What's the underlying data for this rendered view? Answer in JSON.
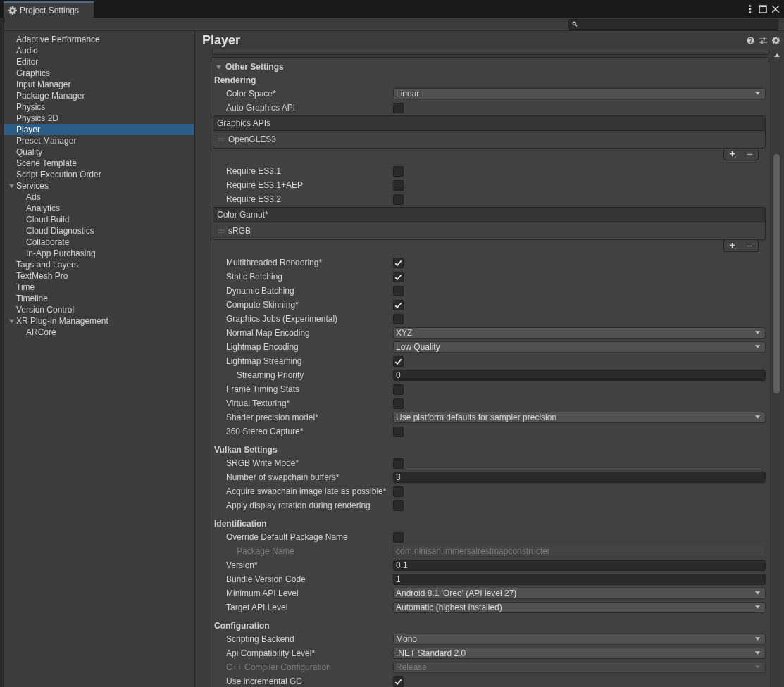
{
  "window": {
    "title": "Project Settings"
  },
  "sidebar": {
    "items": [
      {
        "label": "Adaptive Performance",
        "selected": false
      },
      {
        "label": "Audio",
        "selected": false
      },
      {
        "label": "Editor",
        "selected": false
      },
      {
        "label": "Graphics",
        "selected": false
      },
      {
        "label": "Input Manager",
        "selected": false
      },
      {
        "label": "Package Manager",
        "selected": false
      },
      {
        "label": "Physics",
        "selected": false
      },
      {
        "label": "Physics 2D",
        "selected": false
      },
      {
        "label": "Player",
        "selected": true
      },
      {
        "label": "Preset Manager",
        "selected": false
      },
      {
        "label": "Quality",
        "selected": false
      },
      {
        "label": "Scene Template",
        "selected": false
      },
      {
        "label": "Script Execution Order",
        "selected": false
      },
      {
        "label": "Services",
        "selected": false,
        "expanded": true,
        "children": [
          {
            "label": "Ads",
            "selected": false
          },
          {
            "label": "Analytics",
            "selected": false
          },
          {
            "label": "Cloud Build",
            "selected": false
          },
          {
            "label": "Cloud Diagnostics",
            "selected": false
          },
          {
            "label": "Collaborate",
            "selected": false
          },
          {
            "label": "In-App Purchasing",
            "selected": false
          }
        ]
      },
      {
        "label": "Tags and Layers",
        "selected": false
      },
      {
        "label": "TextMesh Pro",
        "selected": false
      },
      {
        "label": "Time",
        "selected": false
      },
      {
        "label": "Timeline",
        "selected": false
      },
      {
        "label": "Version Control",
        "selected": false
      },
      {
        "label": "XR Plug-in Management",
        "selected": false,
        "expanded": true,
        "children": [
          {
            "label": "ARCore",
            "selected": false
          }
        ]
      }
    ]
  },
  "inspector": {
    "title": "Player",
    "section": {
      "title": "Other Settings",
      "expanded": true,
      "rows": [
        {
          "kind": "heading",
          "label": "Rendering"
        },
        {
          "kind": "dropdown",
          "label": "Color Space*",
          "value": "Linear",
          "disabled": false
        },
        {
          "kind": "checkbox",
          "label": "Auto Graphics API",
          "checked": false,
          "disabled": false
        },
        {
          "kind": "list",
          "label": "Graphics APIs",
          "items": [
            "OpenGLES3"
          ]
        },
        {
          "kind": "checkbox",
          "label": "Require ES3.1",
          "checked": false,
          "disabled": false
        },
        {
          "kind": "checkbox",
          "label": "Require ES3.1+AEP",
          "checked": false,
          "disabled": false
        },
        {
          "kind": "checkbox",
          "label": "Require ES3.2",
          "checked": false,
          "disabled": false
        },
        {
          "kind": "list",
          "label": "Color Gamut*",
          "items": [
            "sRGB"
          ]
        },
        {
          "kind": "checkbox",
          "label": "Multithreaded Rendering*",
          "checked": true,
          "disabled": false
        },
        {
          "kind": "checkbox",
          "label": "Static Batching",
          "checked": true,
          "disabled": false
        },
        {
          "kind": "checkbox",
          "label": "Dynamic Batching",
          "checked": false,
          "disabled": false
        },
        {
          "kind": "checkbox",
          "label": "Compute Skinning*",
          "checked": true,
          "disabled": false
        },
        {
          "kind": "checkbox",
          "label": "Graphics Jobs (Experimental)",
          "checked": false,
          "disabled": false
        },
        {
          "kind": "dropdown",
          "label": "Normal Map Encoding",
          "value": "XYZ",
          "disabled": false
        },
        {
          "kind": "dropdown",
          "label": "Lightmap Encoding",
          "value": "Low Quality",
          "disabled": false
        },
        {
          "kind": "checkbox",
          "label": "Lightmap Streaming",
          "checked": true,
          "disabled": false,
          "children": [
            {
              "kind": "field",
              "label": "Streaming Priority",
              "value": "0",
              "disabled": false
            }
          ]
        },
        {
          "kind": "checkbox",
          "label": "Frame Timing Stats",
          "checked": false,
          "disabled": false
        },
        {
          "kind": "checkbox",
          "label": "Virtual Texturing*",
          "checked": false,
          "disabled": false
        },
        {
          "kind": "dropdown",
          "label": "Shader precision model*",
          "value": "Use platform defaults for sampler precision",
          "disabled": false
        },
        {
          "kind": "checkbox",
          "label": "360 Stereo Capture*",
          "checked": false,
          "disabled": false
        },
        {
          "kind": "heading",
          "label": "Vulkan Settings"
        },
        {
          "kind": "checkbox",
          "label": "SRGB Write Mode*",
          "checked": false,
          "disabled": false
        },
        {
          "kind": "field",
          "label": "Number of swapchain buffers*",
          "value": "3",
          "disabled": false
        },
        {
          "kind": "checkbox",
          "label": "Acquire swapchain image late as possible*",
          "checked": false,
          "disabled": false
        },
        {
          "kind": "checkbox",
          "label": "Apply display rotation during rendering",
          "checked": false,
          "disabled": false
        },
        {
          "kind": "heading",
          "label": "Identification"
        },
        {
          "kind": "checkbox",
          "label": "Override Default Package Name",
          "checked": false,
          "disabled": false,
          "children": [
            {
              "kind": "field",
              "label": "Package Name",
              "value": "com.ninisan.immersalrestmapconstructer",
              "disabled": true
            }
          ]
        },
        {
          "kind": "field",
          "label": "Version*",
          "value": "0.1",
          "disabled": false
        },
        {
          "kind": "field",
          "label": "Bundle Version Code",
          "value": "1",
          "disabled": false
        },
        {
          "kind": "dropdown",
          "label": "Minimum API Level",
          "value": "Android 8.1 'Oreo' (API level 27)",
          "disabled": false
        },
        {
          "kind": "dropdown",
          "label": "Target API Level",
          "value": "Automatic (highest installed)",
          "disabled": false
        },
        {
          "kind": "heading",
          "label": "Configuration"
        },
        {
          "kind": "dropdown",
          "label": "Scripting Backend",
          "value": "Mono",
          "disabled": false
        },
        {
          "kind": "dropdown",
          "label": "Api Compatibility Level*",
          "value": ".NET Standard 2.0",
          "disabled": false
        },
        {
          "kind": "dropdown",
          "label": "C++ Compiler Configuration",
          "value": "Release",
          "disabled": true
        },
        {
          "kind": "checkbox",
          "label": "Use incremental GC",
          "checked": true,
          "disabled": false
        }
      ]
    }
  }
}
